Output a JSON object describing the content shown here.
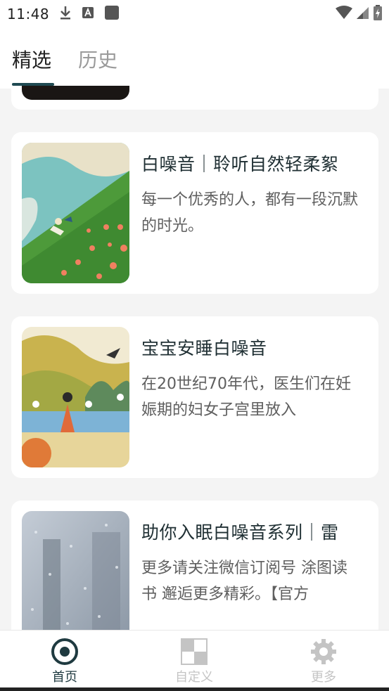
{
  "status_bar": {
    "time": "11:48"
  },
  "tabs": [
    {
      "label": "精选",
      "active": true
    },
    {
      "label": "历史",
      "active": false
    }
  ],
  "cards": [
    {
      "title": "白噪音｜聆听自然轻柔絮",
      "desc": "每一个优秀的人，都有一段沉默的时光。"
    },
    {
      "title": "宝宝安睡白噪音",
      "desc": "在20世纪70年代，医生们在妊娠期的妇女子宫里放入"
    },
    {
      "title": "助你入眠白噪音系列｜雷",
      "desc": "更多请关注微信订阅号 涂图读书 邂逅更多精彩。【官方"
    }
  ],
  "bottom_nav": [
    {
      "label": "首页",
      "icon": "target-icon",
      "active": true
    },
    {
      "label": "自定义",
      "icon": "grid-icon",
      "active": false
    },
    {
      "label": "更多",
      "icon": "gear-icon",
      "active": false
    }
  ],
  "colors": {
    "accent": "#1f4a52",
    "background": "#f4f4f4",
    "inactive": "#c4c4c4"
  }
}
